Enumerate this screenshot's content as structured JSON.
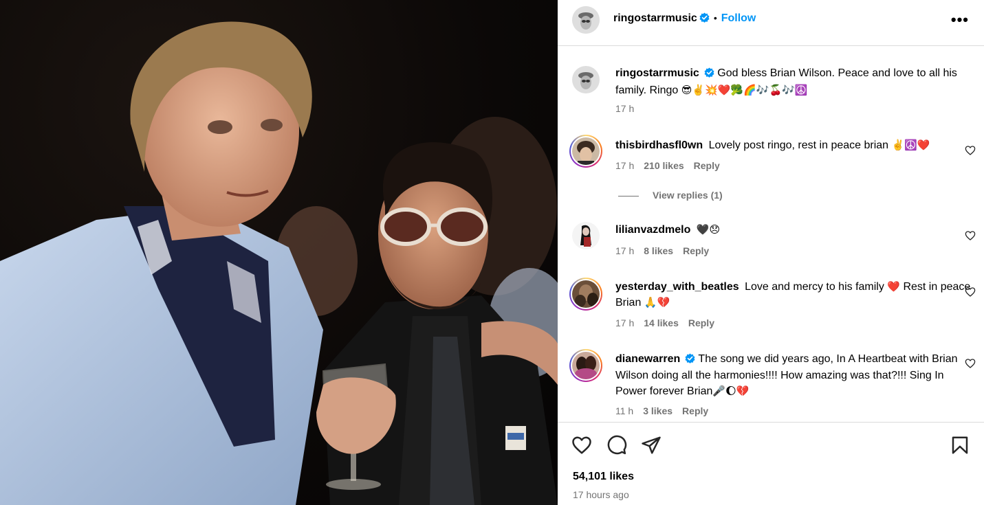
{
  "header": {
    "username": "ringostarrmusic",
    "separator": "•",
    "follow_label": "Follow",
    "more_label": "•••"
  },
  "caption": {
    "username": "ringostarrmusic",
    "text": "God bless Brian Wilson. Peace and love to all his family. Ringo",
    "emojis": "😎✌️💥❤️🥦🌈🎶🍒🎶☮️",
    "time": "17 h"
  },
  "comments": [
    {
      "username": "thisbirdhasfl0wn",
      "text": "Lovely post ringo, rest in peace brian",
      "emojis": "✌️☮️❤️",
      "time": "17 h",
      "likes": "210 likes",
      "reply": "Reply"
    },
    {
      "username": "lilianvazdmelo",
      "text": "",
      "emojis": "🖤😞",
      "time": "17 h",
      "likes": "8 likes",
      "reply": "Reply"
    },
    {
      "username": "yesterday_with_beatles",
      "text": "Love and mercy to his family",
      "emojis_mid": "❤️",
      "text2": "Rest in peace Brian",
      "emojis": "🙏💔",
      "time": "17 h",
      "likes": "14 likes",
      "reply": "Reply"
    },
    {
      "username": "dianewarren",
      "text": "The song we did years ago, In A Heartbeat with Brian Wilson doing all the harmonies!!!! How amazing was that?!!! Sing In Power forever Brian",
      "emojis": "🎤🌔💔",
      "time": "11 h",
      "likes": "3 likes",
      "reply": "Reply"
    }
  ],
  "view_replies": "View replies (1)",
  "footer": {
    "likes": "54,101 likes",
    "time": "17 hours ago"
  },
  "colors": {
    "accent": "#0095f6",
    "verified": "#0095f6",
    "muted": "#737373",
    "border": "#dbdbdb"
  },
  "icons": [
    "more-options-icon",
    "verified-badge-icon",
    "heart-icon",
    "comment-icon",
    "share-icon",
    "bookmark-icon"
  ]
}
